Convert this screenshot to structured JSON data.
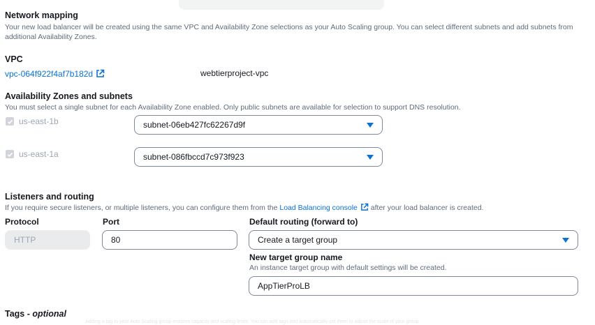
{
  "network": {
    "title": "Network mapping",
    "description": "Your new load balancer will be created using the same VPC and Availability Zone selections as your Auto Scaling group. You can select different subnets and add subnets from additional Availability Zones."
  },
  "vpc": {
    "label": "VPC",
    "id": "vpc-064f922f4af7b182d",
    "name": "webtierproject-vpc"
  },
  "az": {
    "title": "Availability Zones and subnets",
    "description": "You must select a single subnet for each Availability Zone enabled. Only public subnets are available for selection to support DNS resolution.",
    "zones": [
      {
        "name": "us-east-1b",
        "subnet": "subnet-06eb427fc62267d9f"
      },
      {
        "name": "us-east-1a",
        "subnet": "subnet-086fbccd7c973f923"
      }
    ]
  },
  "listeners": {
    "title": "Listeners and routing",
    "desc_before": "If you require secure listeners, or multiple listeners, you can configure them from the",
    "console_link": "Load Balancing console",
    "desc_after": "after your load balancer is created.",
    "protocol_label": "Protocol",
    "protocol_value": "HTTP",
    "port_label": "Port",
    "port_value": "80",
    "routing_label": "Default routing (forward to)",
    "routing_value": "Create a target group",
    "tg_name_label": "New target group name",
    "tg_name_desc": "An instance target group with default settings will be created.",
    "tg_name_value": "AppTierProLB"
  },
  "tags": {
    "title": "Tags - ",
    "optional": "optional",
    "faint_text": "Adding a tag to your Auto Scaling group ensures capacity and scaling limits. You can add tags and automatically set them to adjust the scale of your group."
  },
  "colors": {
    "link": "#0972d3",
    "muted": "#5f6b7a",
    "border": "#7d8998",
    "disabled_bg": "#e9ebed"
  },
  "icons": [
    "external-link-icon",
    "check-icon",
    "caret-down-icon"
  ]
}
